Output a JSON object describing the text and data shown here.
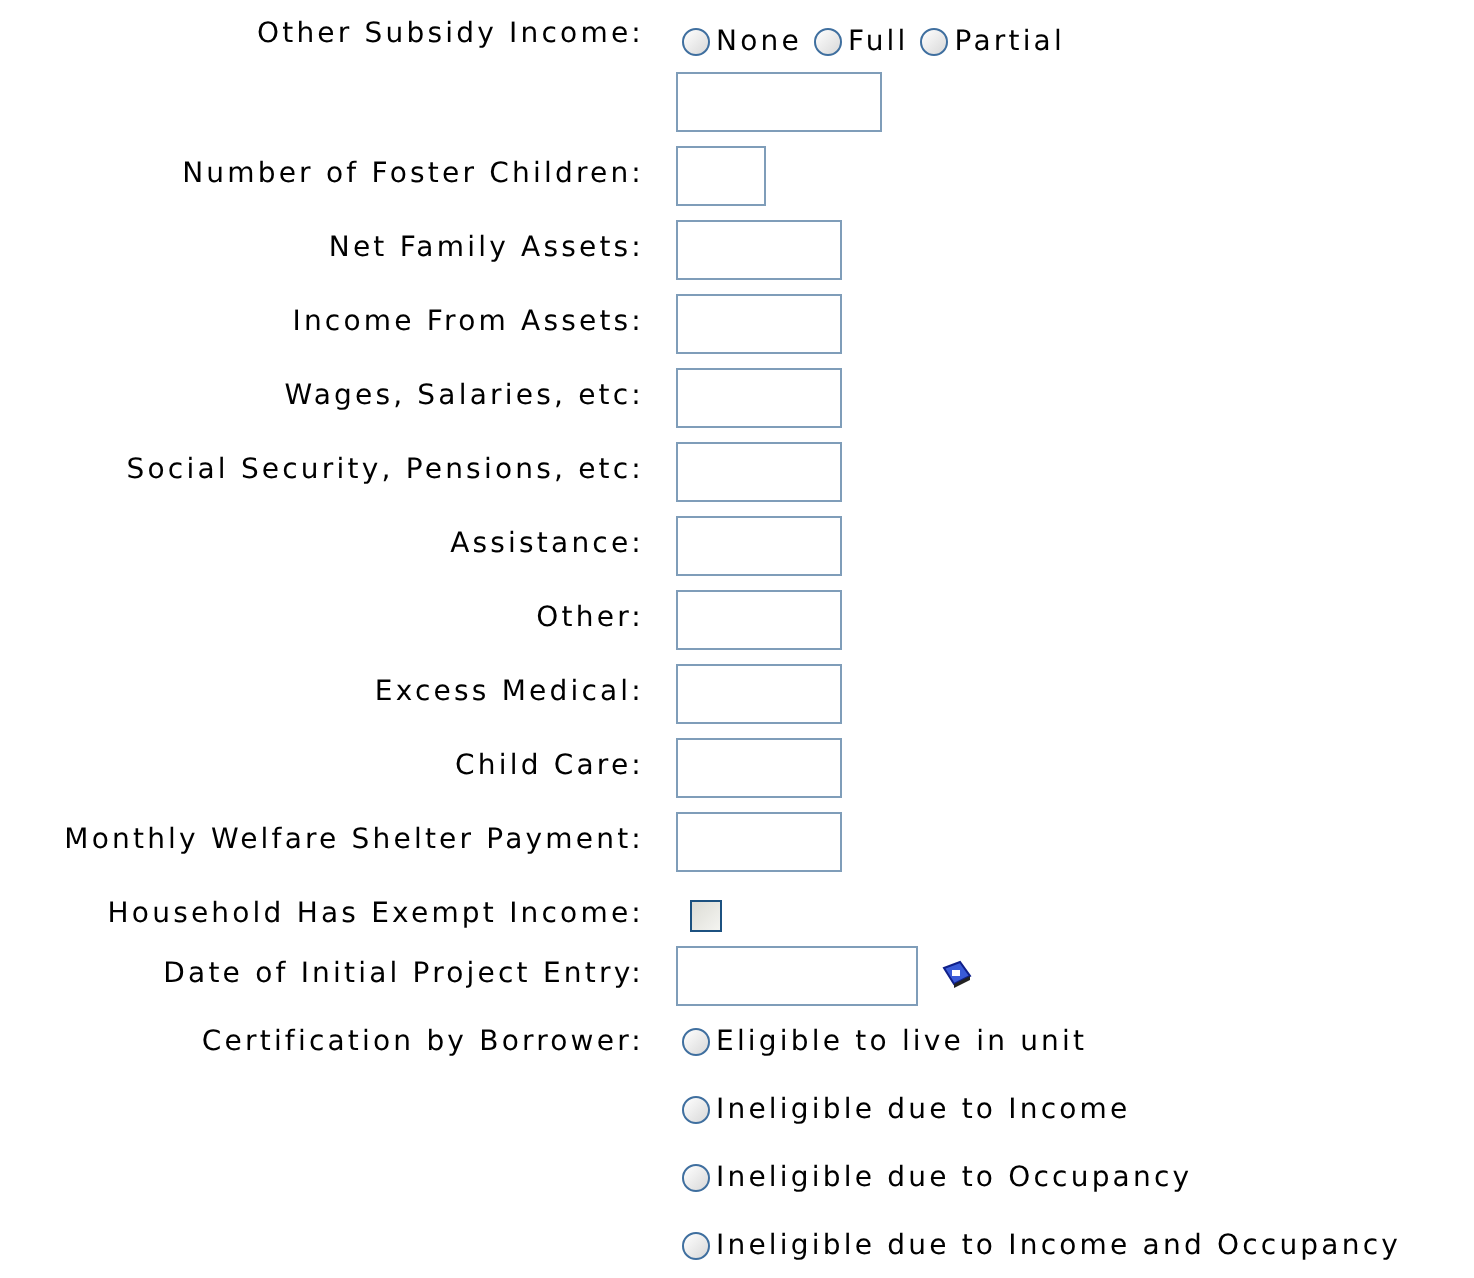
{
  "fields": [
    {
      "kind": "radio_group",
      "label": "Other Subsidy Income:",
      "options": [
        {
          "label": "None",
          "selected": false
        },
        {
          "label": "Full",
          "selected": false
        },
        {
          "label": "Partial",
          "selected": false
        }
      ],
      "amount_field": true
    },
    {
      "kind": "short_input",
      "label": "Number of Foster Children:"
    },
    {
      "kind": "text_input",
      "label": "Net Family Assets:"
    },
    {
      "kind": "text_input",
      "label": "Income From Assets:"
    },
    {
      "kind": "text_input",
      "label": "Wages, Salaries, etc:"
    },
    {
      "kind": "text_input",
      "label": "Social Security, Pensions, etc:"
    },
    {
      "kind": "text_input",
      "label": "Assistance:"
    },
    {
      "kind": "text_input",
      "label": "Other:"
    },
    {
      "kind": "text_input",
      "label": "Excess Medical:"
    },
    {
      "kind": "text_input",
      "label": "Child Care:"
    },
    {
      "kind": "text_input",
      "label": "Monthly Welfare Shelter Payment:"
    },
    {
      "kind": "checkbox",
      "label": "Household Has Exempt Income:",
      "checked": false
    },
    {
      "kind": "date_input",
      "label": "Date of Initial Project Entry:"
    },
    {
      "kind": "radio_list",
      "label": "Certification by Borrower:",
      "options": [
        {
          "label": "Eligible to live in unit",
          "selected": false
        },
        {
          "label": "Ineligible due to Income",
          "selected": false
        },
        {
          "label": "Ineligible due to Occupancy",
          "selected": false
        },
        {
          "label": "Ineligible due to Income and Occupancy",
          "selected": false
        }
      ]
    }
  ]
}
